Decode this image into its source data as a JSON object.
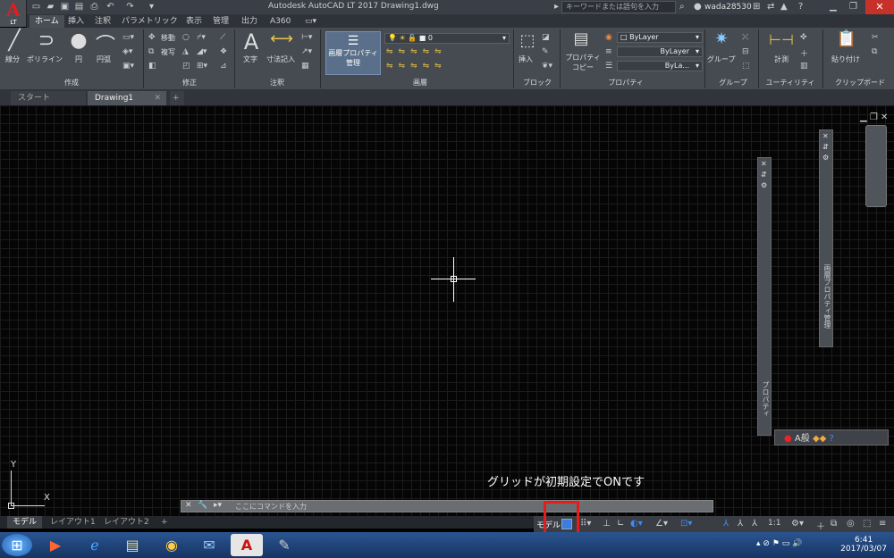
{
  "app": {
    "logo_letter": "A",
    "edition": "LT",
    "title": "Autodesk AutoCAD LT 2017    Drawing1.dwg"
  },
  "titlebar": {
    "search_placeholder": "キーワードまたは語句を入力",
    "user": "wada28530"
  },
  "ribbon_tabs": [
    "ホーム",
    "挿入",
    "注釈",
    "パラメトリック",
    "表示",
    "管理",
    "出力",
    "A360"
  ],
  "panels": {
    "create": {
      "name": "作成",
      "tools": [
        "線分",
        "ポリライン",
        "円",
        "円弧"
      ]
    },
    "modify": {
      "name": "修正",
      "tools": [
        "移動",
        "複写"
      ]
    },
    "annotation": {
      "name": "注釈",
      "tools": [
        "文字",
        "寸法記入"
      ]
    },
    "layers": {
      "name": "画層",
      "big_button": "画層プロパティ管理",
      "current_layer": "0"
    },
    "block": {
      "name": "ブロック",
      "tools": [
        "挿入"
      ]
    },
    "properties": {
      "name": "プロパティ",
      "tools": [
        "プロパティコピー"
      ],
      "color": "ByLayer",
      "linetype": "ByLayer",
      "lineweight": "ByLa..."
    },
    "groups": {
      "name": "グループ",
      "tools": [
        "グループ"
      ]
    },
    "utilities": {
      "name": "ユーティリティ",
      "tools": [
        "計測"
      ]
    },
    "clipboard": {
      "name": "クリップボード",
      "tools": [
        "貼り付け"
      ]
    }
  },
  "doc_tabs": [
    "スタート",
    "Drawing1"
  ],
  "palettes": {
    "properties": "プロパティ",
    "layer_manager": "画層プロパティ管理"
  },
  "ucs": {
    "x": "X",
    "y": "Y"
  },
  "command": {
    "placeholder": "ここにコマンドを入力"
  },
  "annotation_text": "グリッドが初期設定でONです",
  "layout_tabs": [
    "モデル",
    "レイアウト1",
    "レイアウト2"
  ],
  "status": {
    "model": "モデル",
    "scale": "1:1"
  },
  "clock": {
    "time": "6:41",
    "date": "2017/03/07"
  },
  "colors": {
    "ribbon": "#464b52",
    "canvas": "#050505",
    "highlight": "#e51c1c"
  }
}
